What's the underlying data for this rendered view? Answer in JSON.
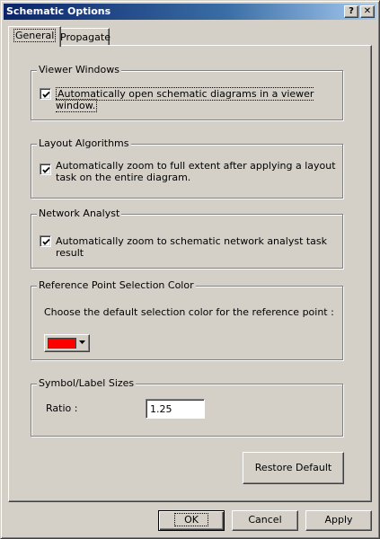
{
  "window": {
    "title": "Schematic Options",
    "help_label": "?",
    "close_label": "✕"
  },
  "tabs": [
    {
      "label": "General",
      "selected": true
    },
    {
      "label": "Propagate",
      "selected": false
    }
  ],
  "groups": {
    "viewer_windows": {
      "title": "Viewer Windows",
      "option": {
        "label": "Automatically open schematic diagrams in a viewer window.",
        "checked": true
      }
    },
    "layout_algorithms": {
      "title": "Layout Algorithms",
      "option": {
        "label_line1": "Automatically zoom to full extent after applying a layout",
        "label_line2": "task on the entire diagram.",
        "checked": true
      }
    },
    "network_analyst": {
      "title": "Network Analyst",
      "option": {
        "label": "Automatically zoom to schematic network analyst task result",
        "checked": true
      }
    },
    "reference_point": {
      "title": "Reference Point Selection Color",
      "description": "Choose the default selection color for the reference point :",
      "color": "#ff0000"
    },
    "symbol_label": {
      "title": "Symbol/Label Sizes",
      "ratio_label": "Ratio :",
      "ratio_value": "1.25"
    }
  },
  "buttons": {
    "restore_default": "Restore Default",
    "ok": "OK",
    "cancel": "Cancel",
    "apply": "Apply"
  }
}
